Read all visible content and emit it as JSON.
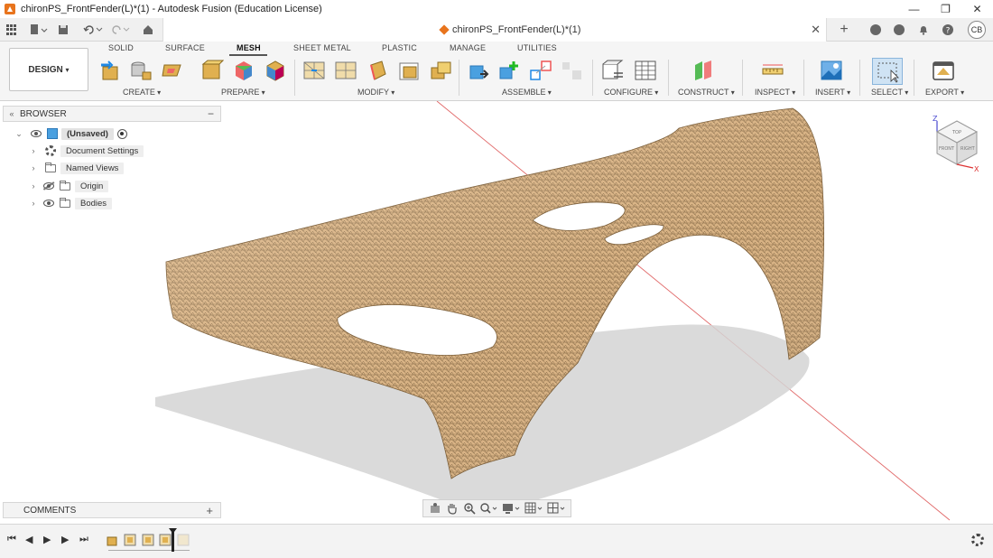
{
  "window": {
    "title": "chironPS_FrontFender(L)*(1) - Autodesk Fusion (Education License)",
    "controls": [
      "—",
      "❐",
      "✕"
    ]
  },
  "tabbar": {
    "document_tab": "chironPS_FrontFender(L)*(1)",
    "close": "✕",
    "new_tab": "+",
    "user_initials": "CB"
  },
  "toolbar": {
    "workspace": "DESIGN",
    "workspace_tabs": [
      "SOLID",
      "SURFACE",
      "MESH",
      "SHEET METAL",
      "PLASTIC",
      "MANAGE",
      "UTILITIES"
    ],
    "active_tab": "MESH",
    "groups": [
      "CREATE",
      "PREPARE",
      "MODIFY",
      "ASSEMBLE",
      "CONFIGURE",
      "CONSTRUCT",
      "INSPECT",
      "INSERT",
      "SELECT",
      "EXPORT"
    ]
  },
  "browser": {
    "title": "BROWSER",
    "collapse": "«",
    "minus": "−",
    "root": "(Unsaved)",
    "items": [
      {
        "label": "Document Settings",
        "icon": "gear-icon"
      },
      {
        "label": "Named Views",
        "icon": "folder-icon"
      },
      {
        "label": "Origin",
        "icon": "folder-icon",
        "hidden": true
      },
      {
        "label": "Bodies",
        "icon": "folder-icon"
      }
    ]
  },
  "comments": {
    "title": "COMMENTS",
    "add": "+"
  },
  "viewcube": {
    "axis_z": "Z",
    "axis_x": "X",
    "face_top": "TOP",
    "face_front": "FRONT",
    "face_right": "RIGHT"
  },
  "colors": {
    "mesh": "#d8b283",
    "accent": "#e8741d",
    "axis_red": "#e06666"
  }
}
